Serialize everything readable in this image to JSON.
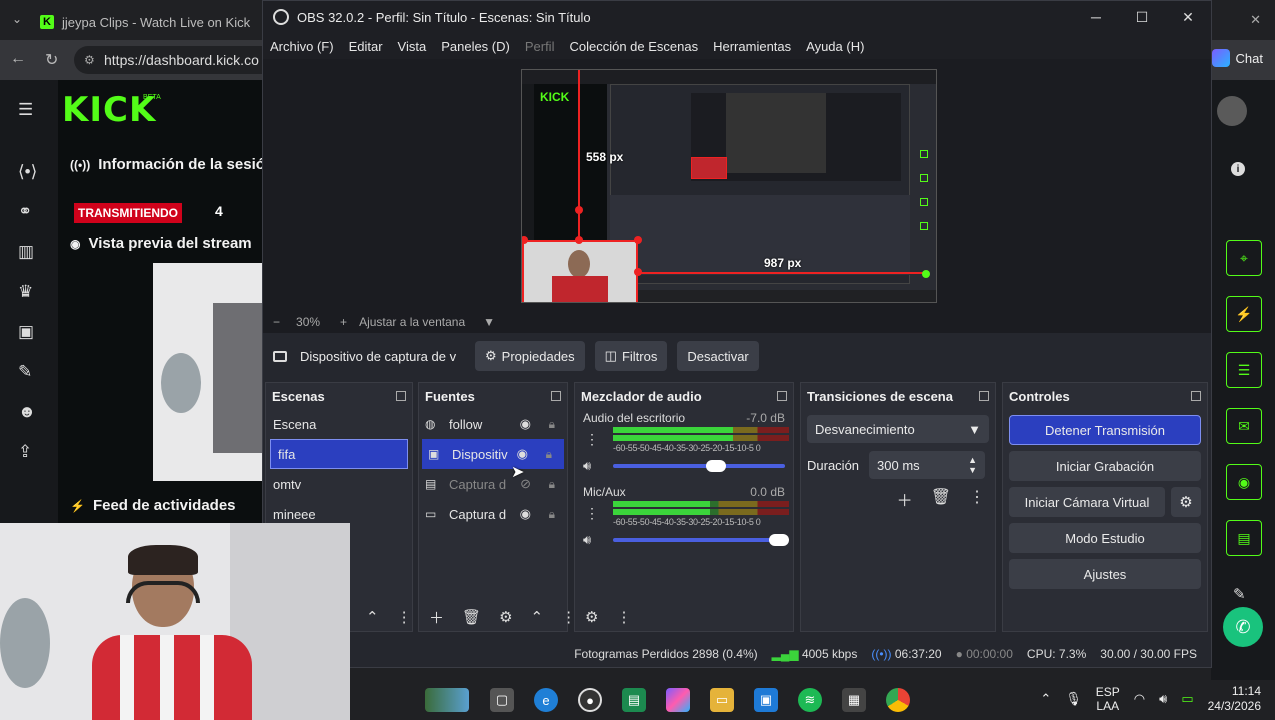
{
  "browser": {
    "tab_title": "jjeypa Clips - Watch Live on Kick",
    "url": "https://dashboard.kick.co",
    "chat_label": "Chat",
    "tab_close": "×",
    "win_close": "✕"
  },
  "kick": {
    "logo": "KICK",
    "beta": "BETA",
    "session_info": "Información de la sesión",
    "live_badge": "TRANSMITIENDO",
    "live_count": "4",
    "stream_preview": "Vista previa del stream",
    "activity_feed": "Feed de actividades",
    "feed_trailing": "F",
    "brand_color": "#53fc18"
  },
  "obs": {
    "title": "OBS 32.0.2 - Perfil: Sin Título - Escenas: Sin Título",
    "menu": [
      "Archivo (F)",
      "Editar",
      "Vista",
      "Paneles (D)",
      "Perfil",
      "Colección de Escenas",
      "Herramientas",
      "Ayuda (H)"
    ],
    "preview": {
      "label_vertical": "558 px",
      "label_horizontal": "987 px",
      "nested_logo": "KICK"
    },
    "zoom": {
      "minus": "−",
      "value": "30%",
      "plus": "+",
      "fit_label": "Ajustar a la ventana",
      "arrow": "▼"
    },
    "source_toolbar": {
      "selected_source": "Dispositivo de captura de v",
      "properties": "Propiedades",
      "filters": "Filtros",
      "deactivate": "Desactivar"
    },
    "scenes": {
      "title": "Escenas",
      "items": [
        "Escena",
        "fifa",
        "omtv",
        "mineee"
      ],
      "selected": "fifa"
    },
    "sources": {
      "title": "Fuentes",
      "items": [
        {
          "name": "follow",
          "icon": "globe-icon"
        },
        {
          "name": "Dispositiv",
          "icon": "camera-icon"
        },
        {
          "name": "Captura d",
          "icon": "window-capture-icon"
        },
        {
          "name": "Captura d",
          "icon": "display-capture-icon"
        }
      ],
      "selected": "Dispositiv"
    },
    "mixer": {
      "title": "Mezclador de audio",
      "scale": "-60-55-50-45-40-35-30-25-20-15-10-5 0",
      "channels": [
        {
          "name": "Audio del escritorio",
          "db": "-7.0 dB",
          "level": 0.68,
          "volume": 0.6
        },
        {
          "name": "Mic/Aux",
          "db": "0.0 dB",
          "level": 0.55,
          "volume": 1.0
        }
      ]
    },
    "transitions": {
      "title": "Transiciones de escena",
      "selected": "Desvanecimiento",
      "duration_label": "Duración",
      "duration_value": "300 ms"
    },
    "controls": {
      "title": "Controles",
      "stop_stream": "Detener Transmisión",
      "start_recording": "Iniciar Grabación",
      "start_virtual_cam": "Iniciar Cámara Virtual",
      "studio_mode": "Modo Estudio",
      "settings": "Ajustes"
    },
    "status": {
      "dropped_frames": "Fotogramas Perdidos 2898 (0.4%)",
      "bitrate": "4005 kbps",
      "stream_time": "06:37:20",
      "record_time": "00:00:00",
      "cpu": "CPU: 7.3%",
      "fps": "30.00 / 30.00 FPS"
    }
  },
  "taskbar": {
    "lang_top": "ESP",
    "lang_bottom": "LAA",
    "time": "11:14",
    "date": "24/3/2026"
  }
}
